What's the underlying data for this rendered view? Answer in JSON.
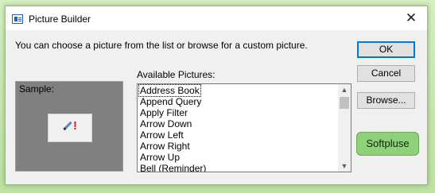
{
  "window": {
    "title": "Picture Builder",
    "close_glyph": "✕"
  },
  "instructions": "You can choose a picture from the list or browse for a custom picture.",
  "buttons": {
    "ok": "OK",
    "cancel": "Cancel",
    "browse": "Browse..."
  },
  "sample": {
    "label": "Sample:",
    "icon": "pencil-exclamation-icon",
    "bang": "!"
  },
  "pictures": {
    "label": "Available Pictures:",
    "selected": "Address Book",
    "items": [
      "Address Book",
      "Append Query",
      "Apply Filter",
      "Arrow Down",
      "Arrow Left",
      "Arrow Right",
      "Arrow Up",
      "Bell (Reminder)"
    ],
    "scroll_up": "▲",
    "scroll_down": "▼"
  },
  "watermark": "Softpluse",
  "colors": {
    "accent": "#0078d7",
    "badge": "#8fd07a",
    "sample_bg": "#808080"
  }
}
